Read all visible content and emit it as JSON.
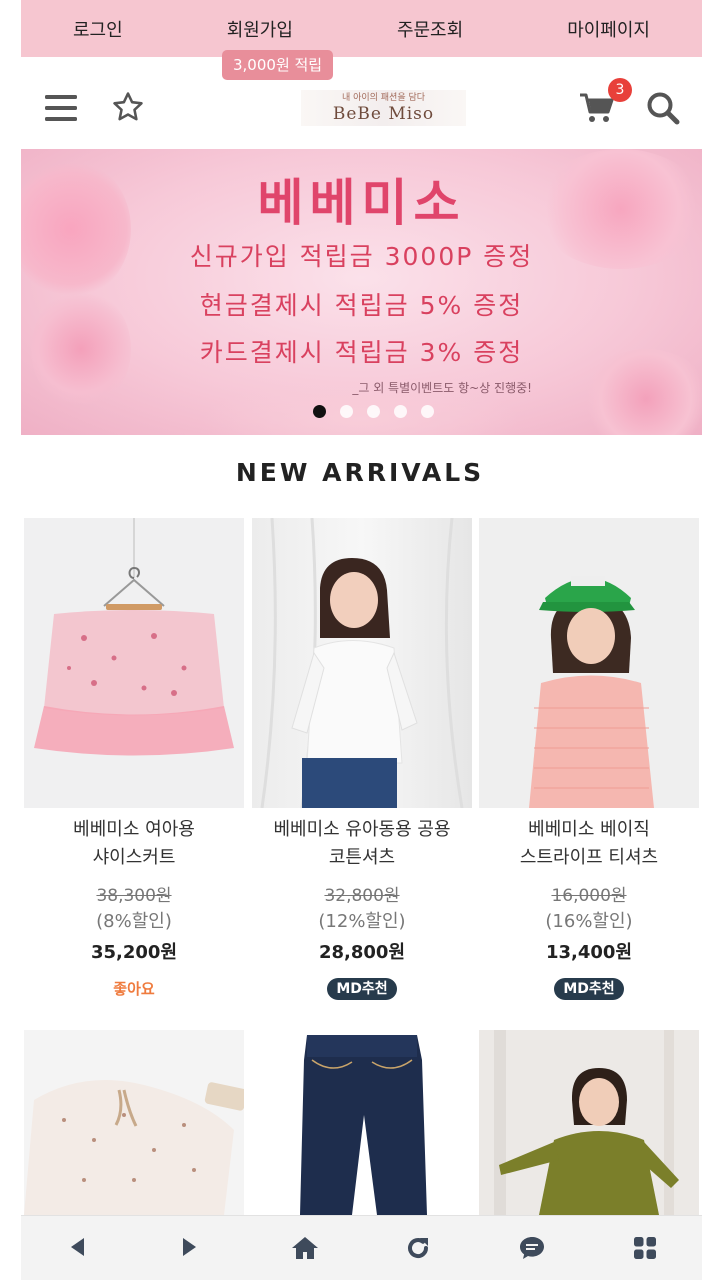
{
  "topnav": {
    "login": "로그인",
    "signup": "회원가입",
    "orders": "주문조회",
    "mypage": "마이페이지",
    "signup_reward": "3,000원 적립"
  },
  "header": {
    "logo_tagline": "내 아이의 패션을 담다",
    "logo_name": "BeBe Miso",
    "cart_count": "3",
    "icons": [
      "menu-icon",
      "star-icon",
      "cart-icon",
      "search-icon"
    ]
  },
  "banner": {
    "title": "베베미소",
    "line1": "신규가입 적립금 3000P 증정",
    "line2": "현금결제시 적립금 5% 증정",
    "line3": "카드결제시 적립금 3% 증정",
    "note": "_그 외 특별이벤트도 항~상 진행중!",
    "slide_count": 5,
    "active_slide": 1
  },
  "section": {
    "title": "NEW ARRIVALS"
  },
  "products": [
    {
      "name1": "베베미소 여아용",
      "name2": "샤이스커트",
      "original_price": "38,300원",
      "discount": "(8%할인)",
      "price": "35,200원",
      "badge": "좋아요"
    },
    {
      "name1": "베베미소 유아동용 공용",
      "name2": "코튼셔츠",
      "original_price": "32,800원",
      "discount": "(12%할인)",
      "price": "28,800원",
      "badge": "MD추천"
    },
    {
      "name1": "베베미소 베이직",
      "name2": "스트라이프 티셔츠",
      "original_price": "16,000원",
      "discount": "(16%할인)",
      "price": "13,400원",
      "badge": "MD추천"
    }
  ],
  "bottom_nav": [
    "back-icon",
    "forward-icon",
    "home-icon",
    "refresh-icon",
    "chat-icon",
    "apps-icon"
  ],
  "colors": {
    "topbar": "#f6c6d0",
    "accent": "#e88e9a",
    "badge_md": "#273b4c",
    "badge_like": "#ef7b3e",
    "cart_badge": "#e8403a"
  }
}
